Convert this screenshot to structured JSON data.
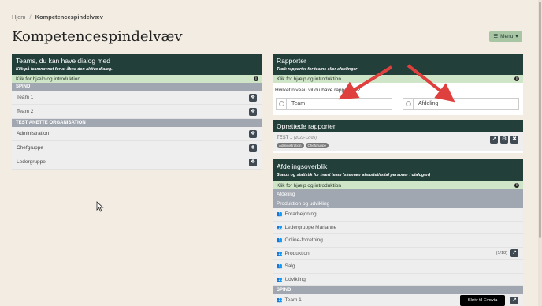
{
  "breadcrumb": {
    "home": "Hjem",
    "separator": "/",
    "current": "Kompetencespindelvæv"
  },
  "page_title": "Kompetencespindelvæv",
  "menu_label": "Menu",
  "teams_panel": {
    "title": "Teams, du kan have dialog med",
    "subtitle": "Klik på teamnavnet for at åbne den aktive dialog.",
    "help": "Klik for hjælp og introduktion",
    "groups": [
      {
        "name": "SPIND",
        "teams": [
          "Team 1",
          "Team 2"
        ]
      },
      {
        "name": "TEST ANETTE ORGANISATION",
        "teams": [
          "Administration",
          "Chefgruppe",
          "Ledergruppe"
        ]
      }
    ]
  },
  "reports_panel": {
    "title": "Rapporter",
    "subtitle": "Træk rapporter for teams eller afdelinger",
    "help": "Klik for hjælp og introduktion",
    "question": "Hvilket niveau vil du have rapport på?",
    "options": [
      "Team",
      "Afdeling"
    ]
  },
  "created_reports": {
    "title": "Oprettede rapporter",
    "report_name": "TEST 1",
    "report_date": "(2023-12-05)",
    "tags": [
      "Administration",
      "Chefgruppe"
    ]
  },
  "dept_overview": {
    "title": "Afdelingsoverblik",
    "subtitle": "Status og statistik for hvert team (skemaer afsluttet/antal personer i dialogen)",
    "help": "Klik for hjælp og introduktion",
    "band_department": "Afdeling",
    "band_group": "Produktion og udvikling",
    "rows": [
      {
        "name": "Forarbejdning",
        "count": ""
      },
      {
        "name": "Ledergruppe Marianne",
        "count": ""
      },
      {
        "name": "Online-forretning",
        "count": ""
      },
      {
        "name": "Produktion",
        "count": "(1/18)"
      },
      {
        "name": "Salg",
        "count": ""
      },
      {
        "name": "Udvikling",
        "count": ""
      }
    ],
    "group2": "SPIND",
    "group2_row": "Team 1"
  },
  "cta_label": "Skriv til Evovia",
  "colors": {
    "header": "#223f3a",
    "help_band": "#cfe5c7",
    "group_band": "#a1a7b0",
    "arrow": "#e0403d",
    "menu": "#a8c6a4"
  }
}
